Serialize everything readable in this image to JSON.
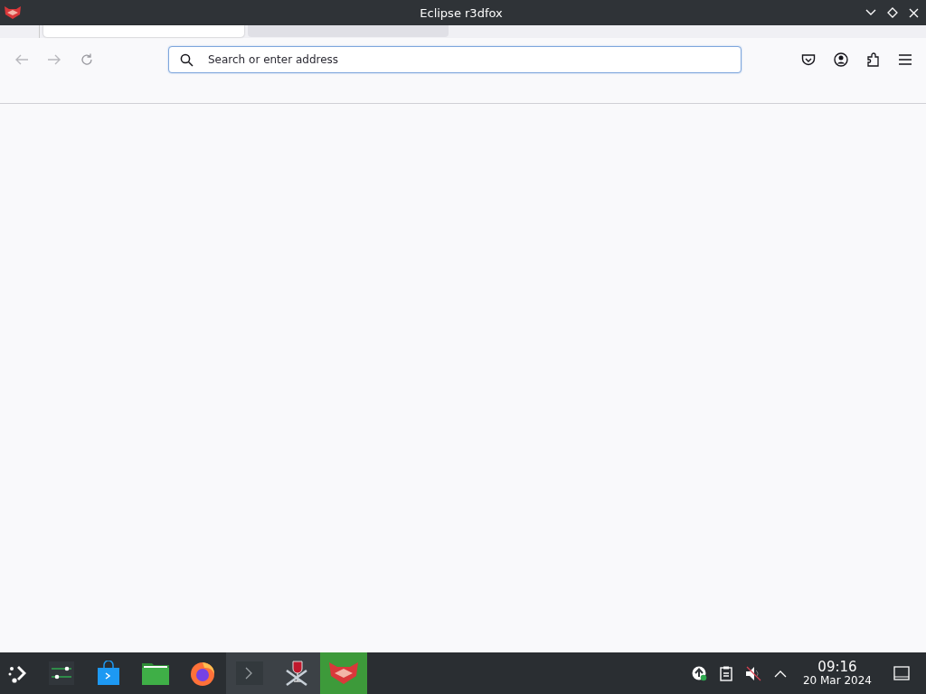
{
  "window": {
    "title": "Eclipse r3dfox"
  },
  "tabs": [
    {
      "selected": true
    },
    {
      "selected": false
    }
  ],
  "toolbar": {
    "back_disabled": true,
    "forward_disabled": true
  },
  "address_bar": {
    "placeholder": "Search or enter address",
    "focused": true
  },
  "taskbar": {
    "tasks": [
      {
        "kind": "settings",
        "open": false,
        "selected": false
      },
      {
        "kind": "store",
        "open": false,
        "selected": false
      },
      {
        "kind": "files",
        "open": false,
        "selected": false
      },
      {
        "kind": "firefox",
        "open": false,
        "selected": false
      },
      {
        "kind": "terminal",
        "open": true,
        "selected": false
      },
      {
        "kind": "wine",
        "open": true,
        "selected": false
      },
      {
        "kind": "r3dfox",
        "open": true,
        "selected": true
      }
    ],
    "time": "09:16",
    "date": "20 Mar 2024"
  }
}
